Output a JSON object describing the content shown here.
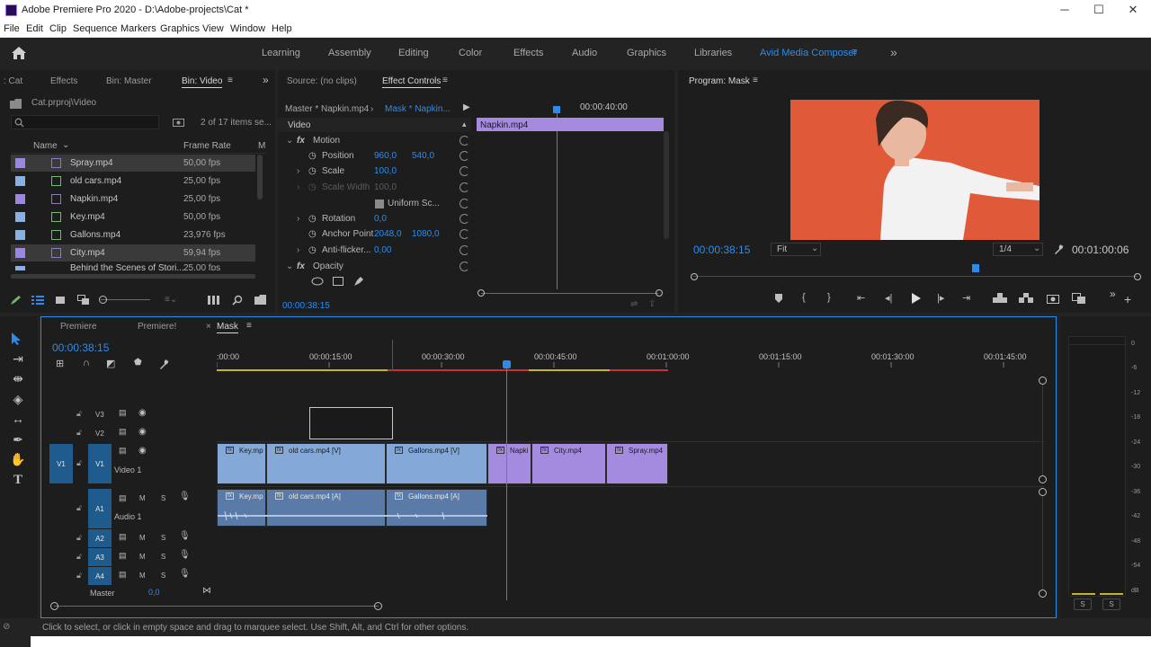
{
  "window": {
    "title": "Adobe Premiere Pro 2020 - D:\\Adobe-projects\\Cat *",
    "controls": [
      "─",
      "☐",
      "✕"
    ]
  },
  "menu": [
    "File",
    "Edit",
    "Clip",
    "Sequence",
    "Markers",
    "Graphics",
    "View",
    "Window",
    "Help"
  ],
  "workspaces": [
    "Learning",
    "Assembly",
    "Editing",
    "Color",
    "Effects",
    "Audio",
    "Graphics",
    "Libraries",
    "Avid Media Composer"
  ],
  "workspace_more": "»",
  "project": {
    "tabs": [
      ": Cat",
      "Effects",
      "Bin: Master",
      "Bin: Video"
    ],
    "path": "Cat.prproj\\Video",
    "items_count": "2 of 17 items se...",
    "columns": {
      "name": "Name",
      "fps": "Frame Rate",
      "more": "M"
    },
    "rows": [
      {
        "name": "Spray.mp4",
        "fps": "50,00 fps",
        "swatch": "#9b86e0",
        "selected": true,
        "kind": "v"
      },
      {
        "name": "old cars.mp4",
        "fps": "25,00 fps",
        "swatch": "#8ab0e0",
        "selected": false,
        "kind": "av"
      },
      {
        "name": "Napkin.mp4",
        "fps": "25,00 fps",
        "swatch": "#9b86e0",
        "selected": false,
        "kind": "v"
      },
      {
        "name": "Key.mp4",
        "fps": "50,00 fps",
        "swatch": "#8ab0e0",
        "selected": false,
        "kind": "av"
      },
      {
        "name": "Gallons.mp4",
        "fps": "23,976 fps",
        "swatch": "#8ab0e0",
        "selected": false,
        "kind": "av"
      },
      {
        "name": "City.mp4",
        "fps": "59,94 fps",
        "swatch": "#9b86e0",
        "selected": true,
        "kind": "v"
      }
    ],
    "partial_row": {
      "name": "Behind the Scenes of Stori...",
      "fps": "25,00 fps"
    }
  },
  "effect_controls": {
    "tabs": [
      "Source: (no clips)",
      "Effect Controls"
    ],
    "master": "Master * Napkin.mp4",
    "sequence_clip": "Mask * Napkin...",
    "timecode": "00:00:40:00",
    "clip_bar": "Napkin.mp4",
    "section": "Video",
    "motion": "Motion",
    "position": {
      "label": "Position",
      "x": "960,0",
      "y": "540,0"
    },
    "scale": {
      "label": "Scale",
      "value": "100,0"
    },
    "scale_width": {
      "label": "Scale Width",
      "value": "100,0"
    },
    "uniform": "Uniform Sc...",
    "rotation": {
      "label": "Rotation",
      "value": "0,0"
    },
    "anchor": {
      "label": "Anchor Point",
      "x": "2048,0",
      "y": "1080,0"
    },
    "antiflicker": {
      "label": "Anti-flicker...",
      "value": "0,00"
    },
    "opacity": "Opacity",
    "current_time": "00:00:38:15"
  },
  "program": {
    "title": "Program: Mask",
    "timecode": "00:00:38:15",
    "fit": "Fit",
    "resolution": "1/4",
    "duration": "00:01:00:06"
  },
  "timeline": {
    "tabs": [
      "Premiere",
      "Premiere!",
      "Mask"
    ],
    "close": "×",
    "timecode": "00:00:38:15",
    "ruler": [
      ":00:00",
      "00:00:15:00",
      "00:00:30:00",
      "00:00:45:00",
      "00:01:00:00",
      "00:01:15:00",
      "00:01:30:00",
      "00:01:45:00"
    ],
    "tracks": {
      "v3": "V3",
      "v2": "V2",
      "v1": "V1",
      "v1_src": "V1",
      "video1": "Video 1",
      "a1": "A1",
      "audio1": "Audio 1",
      "a2": "A2",
      "a3": "A3",
      "a4": "A4",
      "master": "Master",
      "master_val": "0,0",
      "m": "M",
      "s": "S"
    },
    "video_clips": [
      "Key.mp",
      "old cars.mp4 [V]",
      "Gallons.mp4 [V]",
      "Napki",
      "City.mp4",
      "Spray.mp4"
    ],
    "audio_clips": [
      "Key.mp",
      "old cars.mp4 [A]",
      "Gallons.mp4 [A]"
    ]
  },
  "meter": {
    "labels": [
      "0",
      "-6",
      "-12",
      "-18",
      "-24",
      "-30",
      "-36",
      "-42",
      "-48",
      "-54",
      "dB"
    ],
    "solo": [
      "S",
      "S"
    ]
  },
  "status": "Click to select, or click in empty space and drag to marquee select. Use Shift, Alt, and Ctrl for other options.",
  "colors": {
    "accent": "#2d8ceb",
    "video_clip": "#84a9d9",
    "video_clip_alt": "#a58be0",
    "track_blue": "#1f5b8c",
    "backdrop": "#e25b3b"
  }
}
